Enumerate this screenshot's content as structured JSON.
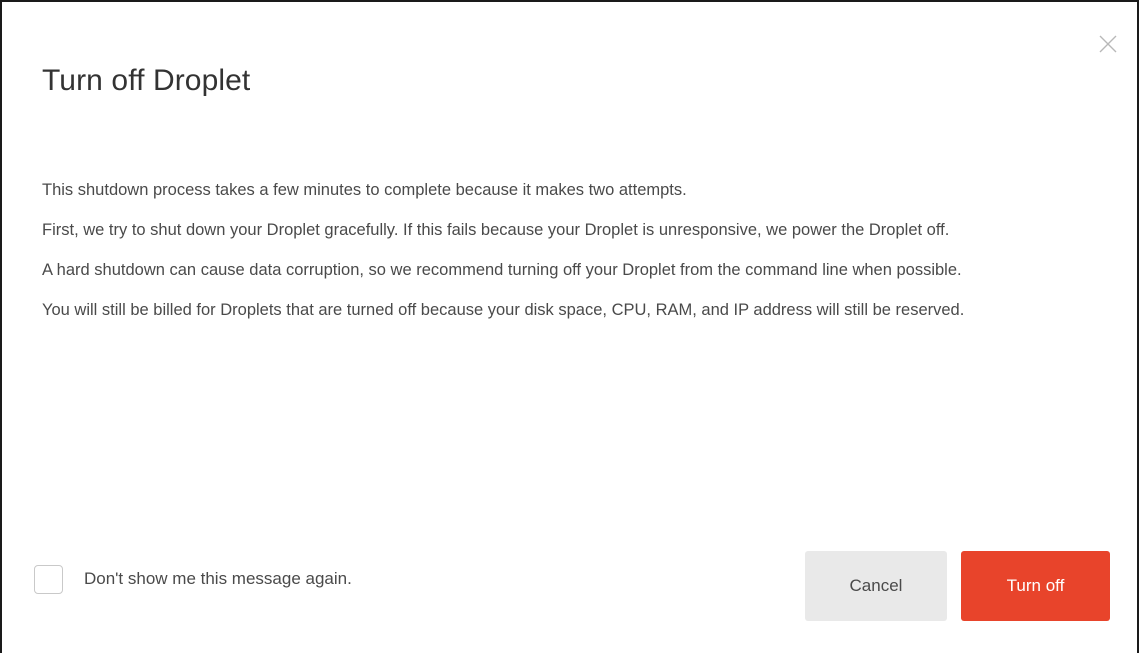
{
  "dialog": {
    "title": "Turn off Droplet",
    "close_icon": "close-icon",
    "paragraphs": [
      "This shutdown process takes a few minutes to complete because it makes two attempts.",
      "First, we try to shut down your Droplet gracefully. If this fails because your Droplet is unresponsive, we power the Droplet off.",
      "A hard shutdown can cause data corruption, so we recommend turning off your Droplet from the command line when possible.",
      "You will still be billed for Droplets that are turned off because your disk space, CPU, RAM, and IP address will still be reserved."
    ],
    "checkbox": {
      "label": "Don't show me this message again.",
      "checked": false
    },
    "buttons": {
      "cancel_label": "Cancel",
      "confirm_label": "Turn off"
    },
    "colors": {
      "primary": "#e8442b",
      "secondary": "#e9e9e9",
      "text": "#4a4a4a",
      "title": "#333333"
    }
  }
}
